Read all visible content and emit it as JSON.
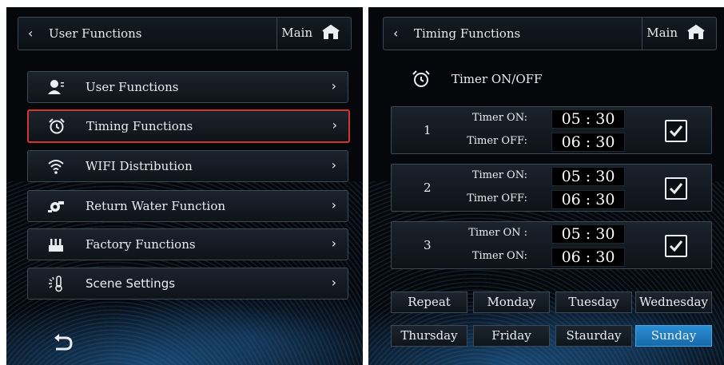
{
  "left": {
    "header": {
      "back_icon": "chevron-left-icon",
      "title": "User Functions",
      "main_label": "Main",
      "home_icon": "home-icon"
    },
    "menu": [
      {
        "label": "User Functions",
        "icon": "user-settings-icon",
        "selected": false
      },
      {
        "label": "Timing Functions",
        "icon": "alarm-clock-icon",
        "selected": true
      },
      {
        "label": "WIFI Distribution",
        "icon": "wifi-icon",
        "selected": false
      },
      {
        "label": "Return Water Function",
        "icon": "pump-icon",
        "selected": false
      },
      {
        "label": "Factory Functions",
        "icon": "factory-icon",
        "selected": false
      },
      {
        "label": "Scene Settings",
        "icon": "thermometer-sun-icon",
        "selected": false
      }
    ],
    "back_button_icon": "return-arrow-icon"
  },
  "right": {
    "header": {
      "back_icon": "chevron-left-icon",
      "title": "Timing Functions",
      "main_label": "Main",
      "home_icon": "home-icon"
    },
    "timer_title": "Timer ON/OFF",
    "timers": [
      {
        "num": "1",
        "on_label": "Timer ON:",
        "off_label": "Timer OFF:",
        "on_h": "05",
        "on_m": "30",
        "off_h": "06",
        "off_m": "30",
        "checked": true
      },
      {
        "num": "2",
        "on_label": "Timer ON:",
        "off_label": "Timer OFF:",
        "on_h": "05",
        "on_m": "30",
        "off_h": "06",
        "off_m": "30",
        "checked": true
      },
      {
        "num": "3",
        "on_label": "Timer ON :",
        "off_label": "Timer ON:",
        "on_h": "05",
        "on_m": "30",
        "off_h": "06",
        "off_m": "30",
        "checked": true
      }
    ],
    "time_separator": ":",
    "days_row1": [
      "Repeat",
      "Monday",
      "Tuesday",
      "Wednesday"
    ],
    "days_row2": [
      "Thursday",
      "Friday",
      "Staurday",
      "Sunday"
    ],
    "active_day": "Sunday",
    "colors": {
      "active_day": "#2a8fd4",
      "selection_border": "#d6362a"
    }
  }
}
